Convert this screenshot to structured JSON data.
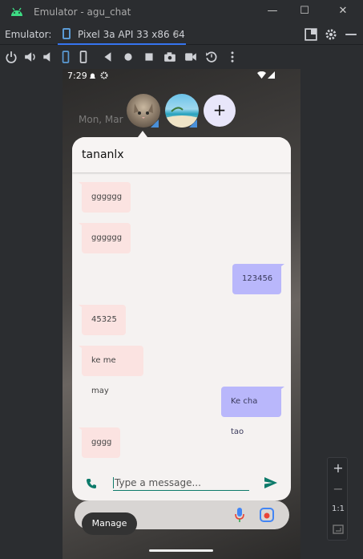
{
  "window": {
    "title": "Emulator - agu_chat",
    "minimize": "—",
    "maximize": "☐",
    "close": "✕"
  },
  "toolbar": {
    "label": "Emulator:",
    "tab_title": "Pixel 3a API 33 x86 64",
    "tab_close": "×"
  },
  "device_toolbar": {
    "icons": [
      "power-icon",
      "volume-up-icon",
      "volume-down-icon",
      "rotate-left-icon",
      "rotate-right-icon",
      "back-icon",
      "home-icon",
      "overview-icon",
      "screenshot-icon",
      "screen-record-icon",
      "snapshot-icon",
      "more-icon"
    ]
  },
  "status_bar": {
    "time": "7:29"
  },
  "bubbles": {
    "add": "+"
  },
  "chat": {
    "title": "tananlx",
    "messages": [
      {
        "text": "gggggg",
        "direction": "in"
      },
      {
        "text": "gggggg",
        "direction": "in"
      },
      {
        "text": "123456",
        "direction": "out"
      },
      {
        "text": "45325",
        "direction": "in"
      },
      {
        "text": "ke me may",
        "direction": "in"
      },
      {
        "text": "Ke cha tao",
        "direction": "out"
      },
      {
        "text": "gggg",
        "direction": "in"
      }
    ],
    "input_placeholder": "Type a message..."
  },
  "manage_label": "Manage",
  "wallpaper_text": "Mon, Mar",
  "zoom": {
    "plus": "+",
    "minus": "−",
    "actual": "1:1"
  },
  "colors": {
    "incoming": "#fbe3e1",
    "outgoing": "#b9b7fb",
    "accent": "#0d7a6a"
  }
}
